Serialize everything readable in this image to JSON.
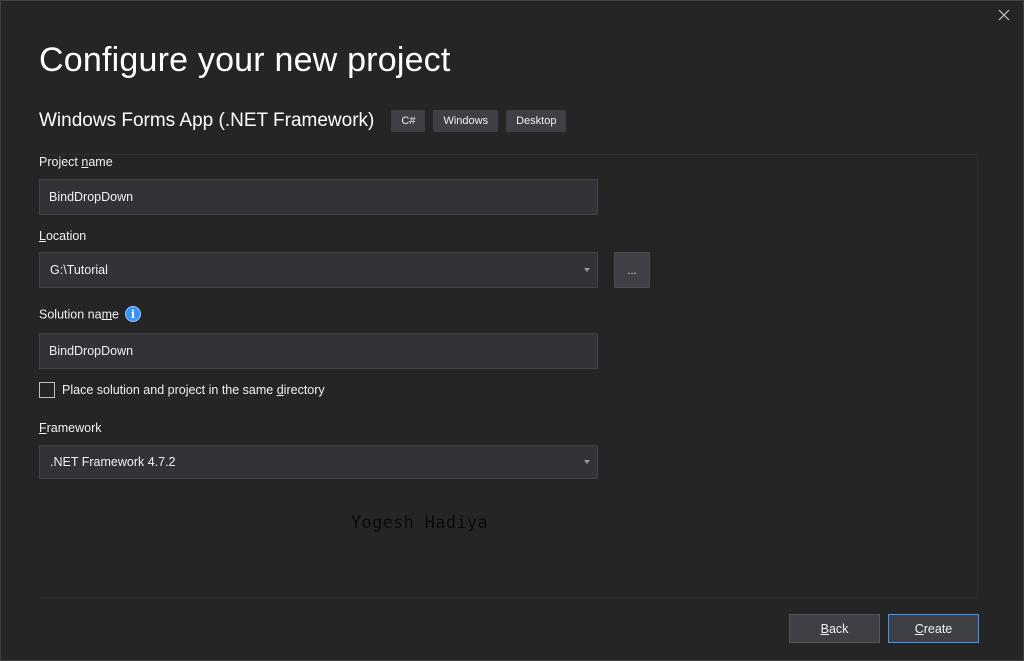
{
  "dialog": {
    "title": "Configure your new project",
    "template_name": "Windows Forms App (.NET Framework)",
    "tags": [
      "C#",
      "Windows",
      "Desktop"
    ]
  },
  "fields": {
    "project_name": {
      "label_pre": "Project ",
      "label_mnemonic": "n",
      "label_post": "ame",
      "value": "BindDropDown"
    },
    "location": {
      "label_pre": "",
      "label_mnemonic": "L",
      "label_post": "ocation",
      "value": "G:\\Tutorial",
      "browse_label": "..."
    },
    "solution_name": {
      "label_pre": "Solution na",
      "label_mnemonic": "m",
      "label_post": "e",
      "value": "BindDropDown",
      "info_glyph": "i"
    },
    "same_directory": {
      "label_pre": "Place solution and project in the same ",
      "label_mnemonic": "d",
      "label_post": "irectory",
      "checked": false
    },
    "framework": {
      "label_pre": "",
      "label_mnemonic": "F",
      "label_post": "ramework",
      "value": ".NET Framework 4.7.2"
    }
  },
  "watermark": "Yogesh Hadiya",
  "footer": {
    "back_mnemonic": "B",
    "back_rest": "ack",
    "create_mnemonic": "C",
    "create_rest": "reate"
  },
  "colors": {
    "background": "#252526",
    "input_bg": "#333337",
    "accent": "#3399ff"
  },
  "icons": {
    "close": "close-icon",
    "info": "info-icon",
    "dropdown": "chevron-down-icon"
  }
}
